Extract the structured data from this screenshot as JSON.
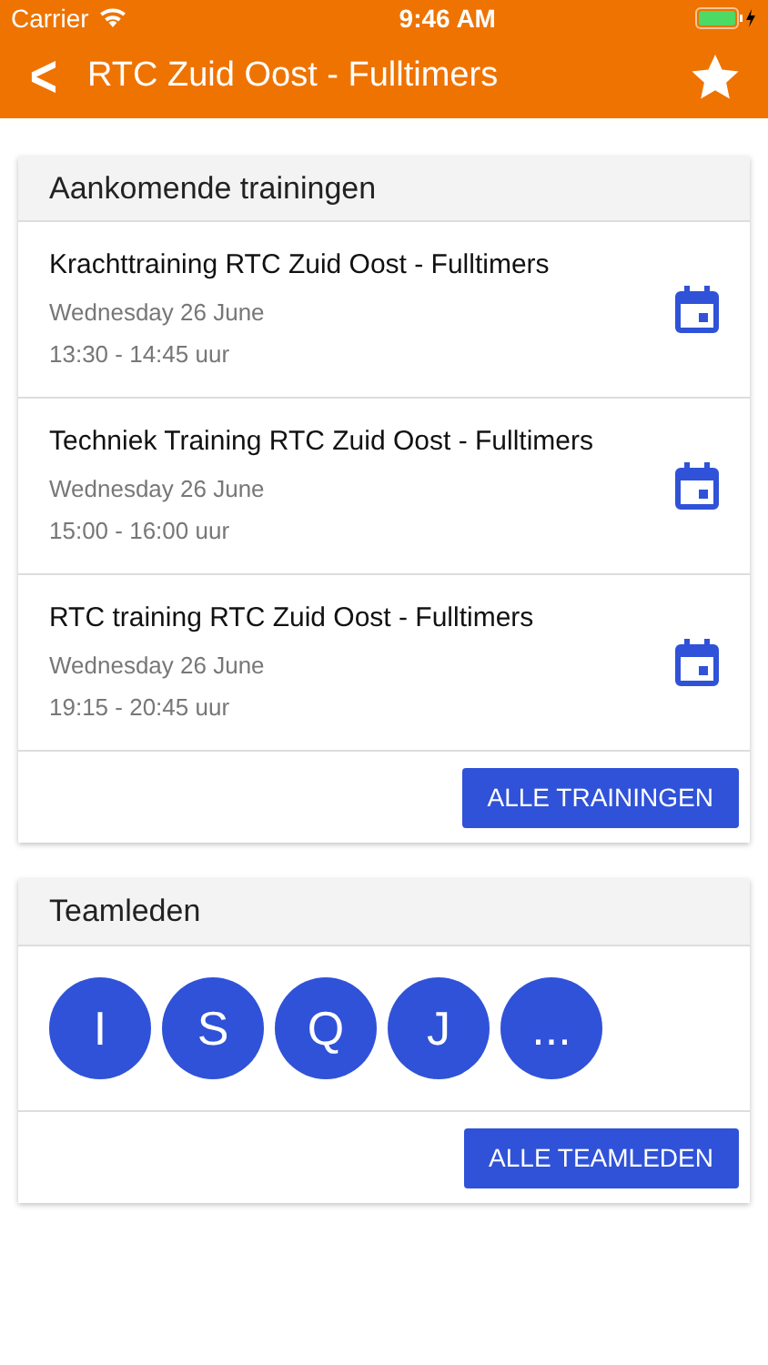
{
  "status_bar": {
    "carrier": "Carrier",
    "time": "9:46 AM"
  },
  "nav_bar": {
    "back": "<",
    "title": "RTC Zuid Oost - Fulltimers"
  },
  "upcoming": {
    "title": "Aankomende trainingen",
    "button": "ALLE TRAININGEN",
    "trainings": [
      {
        "name": "Krachttraining RTC Zuid Oost - Fulltimers",
        "date": "Wednesday 26 June",
        "time": "13:30 - 14:45 uur"
      },
      {
        "name": "Techniek Training RTC Zuid Oost - Fulltimers",
        "date": "Wednesday 26 June",
        "time": "15:00 - 16:00 uur"
      },
      {
        "name": "RTC training RTC Zuid Oost - Fulltimers",
        "date": "Wednesday 26 June",
        "time": "19:15 - 20:45 uur"
      }
    ]
  },
  "team": {
    "title": "Teamleden",
    "button": "ALLE TEAMLEDEN",
    "members": [
      "I",
      "S",
      "Q",
      "J",
      "..."
    ]
  }
}
